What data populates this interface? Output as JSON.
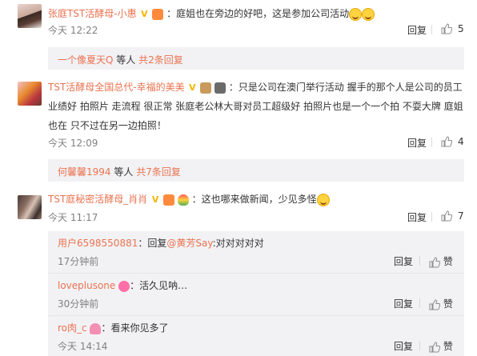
{
  "comments": [
    {
      "username": "张庭TST活酵母-小惠",
      "text": "：庭姐也在旁边的好吧，这是参加公司活动",
      "time": "今天 12:22",
      "reply_label": "回复",
      "likes": "5",
      "more_replies": {
        "names": "一个像夏天Q",
        "mid": "等人",
        "count": "共2条回复"
      }
    },
    {
      "username": "TST活酵母全国总代-幸福的美美",
      "text": "：只是公司在澳门举行活动 握手的那个人是公司的员工业绩好 拍照片 走流程 很正常 张庭老公林大哥对员工超级好 拍照片也是一个一个拍 不耍大牌 庭姐也在 只不过在另一边拍照！",
      "time": "今天 12:09",
      "reply_label": "回复",
      "likes": "4",
      "more_replies": {
        "names": "何馨馨1994",
        "mid": "等人",
        "count": "共7条回复"
      }
    },
    {
      "username": "TST庭秘密活酵母_肖肖",
      "text": "：这也哪来做新闻，少见多怪",
      "time": "今天 11:17",
      "reply_label": "回复",
      "likes": "7"
    }
  ],
  "sub_replies": [
    {
      "username": "用户6598550881",
      "prefix": "：回复",
      "mention": "@黄芳Say",
      "text": ":对对对对对",
      "time": "17分钟前",
      "reply_label": "回复",
      "like_label": "赞"
    },
    {
      "username": "loveplusone",
      "text": "：活久见呐…",
      "time": "30分钟前",
      "reply_label": "回复",
      "like_label": "赞"
    },
    {
      "username": "ro肉_c",
      "text": "：看来你见多了",
      "time": "今天 14:14",
      "reply_label": "回复",
      "like_label": "赞"
    }
  ],
  "colors": {
    "link": "#eb7350",
    "text": "#333333",
    "muted": "#808080",
    "panel": "#f2f2f5"
  },
  "icons": [
    "verified-v-badge",
    "gift-badge",
    "laugh-emoji",
    "thumb-up-icon",
    "balloon-badge",
    "donut-badge",
    "butterfly-badge"
  ]
}
